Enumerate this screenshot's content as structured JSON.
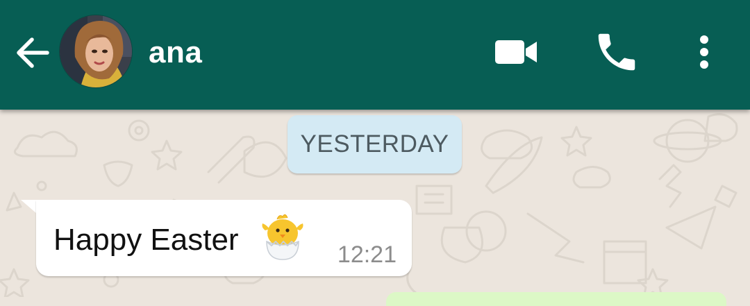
{
  "header": {
    "contact_name": "ana",
    "back_icon": "arrow-left-icon",
    "video_icon": "video-camera-icon",
    "call_icon": "phone-icon",
    "menu_icon": "more-vertical-icon"
  },
  "chat": {
    "date_separator": "YESTERDAY",
    "messages": [
      {
        "direction": "incoming",
        "text": "Happy Easter",
        "emoji": "hatching-chick-icon",
        "time": "12:21"
      }
    ]
  },
  "colors": {
    "header": "#075e54",
    "background": "#ece5dd",
    "incoming_bubble": "#ffffff",
    "outgoing_bubble": "#dcf8c6",
    "date_chip": "#d4eaf4"
  }
}
